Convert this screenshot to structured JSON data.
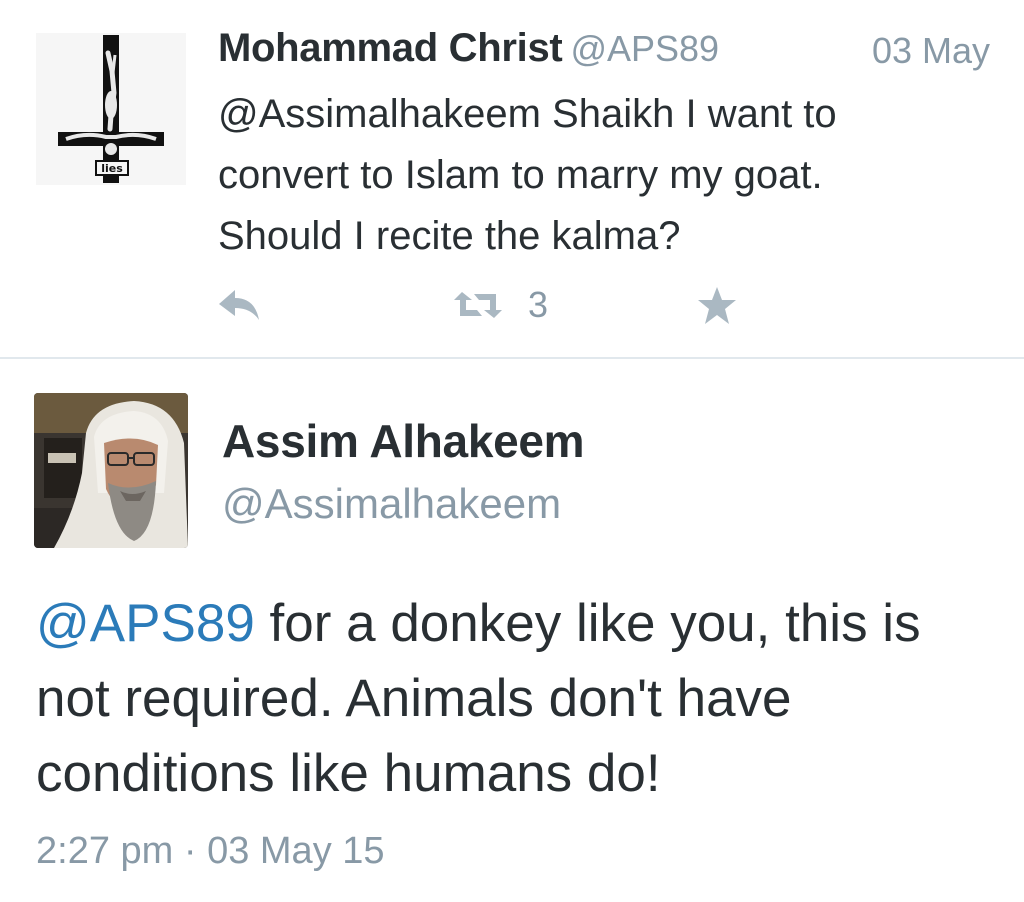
{
  "tweet1": {
    "name": "Mohammad Christ",
    "handle": "@APS89",
    "date": "03 May",
    "text_lines": [
      "@Assimalhakeem Shaikh I want to",
      "convert to Islam to marry my goat.",
      "Should I recite the kalma?"
    ],
    "avatar_icon": "inverted-crucifix-icon",
    "avatar_label": "lies",
    "actions": {
      "reply_icon": "reply-icon",
      "retweet_icon": "retweet-icon",
      "retweet_count": "3",
      "favorite_icon": "star-icon"
    }
  },
  "tweet2": {
    "name": "Assim Alhakeem",
    "handle": "@Assimalhakeem",
    "avatar_icon": "profile-photo",
    "mention": "@APS89",
    "text": " for a donkey like you, this is not required. Animals don't have conditions like humans do!",
    "timestamp": "2:27 pm · 03 May 15"
  },
  "colors": {
    "text": "#292f33",
    "muted": "#8899a6",
    "link": "#2b7bb9",
    "divider": "#e1e8ed",
    "icon": "#aab8c2"
  }
}
